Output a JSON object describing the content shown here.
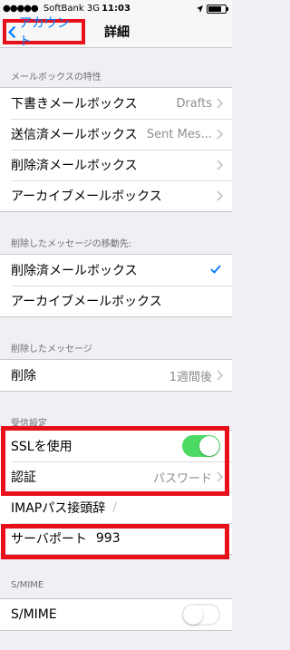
{
  "status": {
    "carrier": "SoftBank",
    "network": "3G",
    "time": "11:03"
  },
  "nav": {
    "back_label": "アカウント",
    "title": "詳細"
  },
  "sections": {
    "mailbox": {
      "header": "メールボックスの特性",
      "rows": [
        {
          "label": "下書きメールボックス",
          "value": "Drafts"
        },
        {
          "label": "送信済メールボックス",
          "value": "Sent Mes..."
        },
        {
          "label": "削除済メールボックス",
          "value": ""
        },
        {
          "label": "アーカイブメールボックス",
          "value": ""
        }
      ]
    },
    "move_deleted": {
      "header": "削除したメッセージの移動先:",
      "rows": [
        {
          "label": "削除済メールボックス",
          "selected": true
        },
        {
          "label": "アーカイブメールボックス",
          "selected": false
        }
      ]
    },
    "deleted_msgs": {
      "header": "削除したメッセージ",
      "rows": [
        {
          "label": "削除",
          "value": "1週間後"
        }
      ]
    },
    "incoming": {
      "header": "受信設定",
      "ssl_label": "SSLを使用",
      "ssl_on": true,
      "auth_label": "認証",
      "auth_value": "パスワード",
      "imap_label": "IMAPパス接頭辞",
      "imap_value": "/",
      "port_label": "サーバポート",
      "port_value": "993"
    },
    "smime": {
      "header": "S/MIME",
      "label": "S/MIME",
      "on": false
    }
  },
  "colors": {
    "accent": "#007aff",
    "toggle_on": "#4cd964",
    "highlight": "#e8101a"
  }
}
